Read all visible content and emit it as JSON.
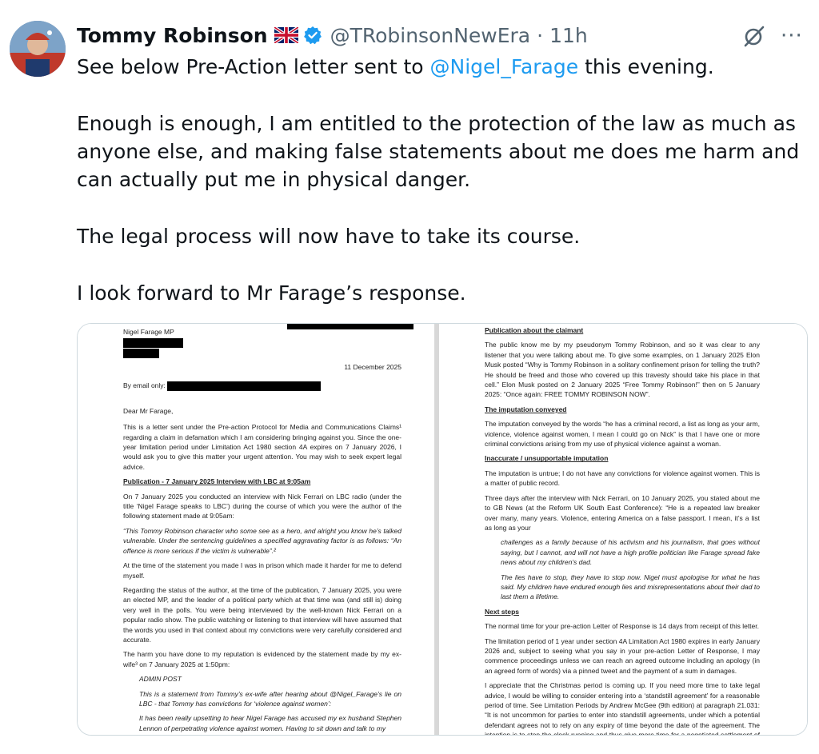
{
  "tweet": {
    "author_name": "Tommy Robinson",
    "flag_icon": "uk-flag-icon",
    "handle": "@TRobinsonNewEra",
    "separator": "·",
    "time": "11h",
    "more_label": "···",
    "text_1": "See below Pre-Action letter sent to",
    "mention": "@Nigel_Farage",
    "text_1_end": "this evening.",
    "paragraph_2": "Enough is enough, I am entitled to the protection of the law as much as anyone else, and making false statements about me does me harm and can actually put me in physical danger.",
    "paragraph_3": "The legal process will now have to take its course.",
    "paragraph_4": "I look forward to Mr Farage’s response.",
    "accent_color": "#1d9bf0",
    "verified_color": "#1d9bf0"
  },
  "letter_left": {
    "recipient": "Nigel Farage MP",
    "date": "11 December 2025",
    "by_email": "By email only:",
    "salutation": "Dear Mr Farage,",
    "p1": "This is a letter sent under the Pre-action Protocol for Media and Communications Claims¹ regarding a claim in defamation which I am considering bringing against you. Since the one-year limitation period under Limitation Act 1980 section 4A expires on 7 January 2026, I would ask you to give this matter your urgent attention. You may wish to seek expert legal advice.",
    "heading_publication": "Publication - 7 January 2025 Interview with LBC at 9:05am",
    "p2": "On 7 January 2025 you conducted an interview with Nick Ferrari on LBC radio (under the title ‘Nigel Farage speaks to LBC’) during the course of which you were the author of the following statement made at 9:05am:",
    "quote1": "“This Tommy Robinson character who some see as a hero, and alright you know he’s talked vulnerable. Under the sentencing guidelines a specified aggravating factor is as follows: “An offence is more serious if the victim is vulnerable”.²",
    "p3": "At the time of the statement you made I was in prison which made it harder for me to defend myself.",
    "p4": "Regarding the status of the author, at the time of the publication, 7 January 2025, you were an elected MP, and the leader of a political party which at that time was (and still is) doing very well in the polls. You were being interviewed by the well-known Nick Ferrari on a popular radio show. The public watching or listening to that interview will have assumed that the words you used in that context about my convictions were very carefully considered and accurate.",
    "p5": "The harm you have done to my reputation is evidenced by the statement made by my ex-wife³ on 7 January 2025 at 1:50pm:",
    "admin_post": "ADMIN POST",
    "quote2": "This is a statement from Tommy’s ex-wife after hearing about @Nigel_Farage’s lie on LBC - that Tommy has convictions for ‘violence against women’:",
    "quote3": "It has been really upsetting to hear Nigel Farage has accused my ex husband Stephen Lennon of perpetrating violence against women. Having to sit down and talk to my"
  },
  "letter_right": {
    "h_publication": "Publication about the claimant",
    "p1": "The public know me by my pseudonym Tommy Robinson, and so it was clear to any listener that you were talking about me. To give some examples, on 1 January 2025 Elon Musk posted “Why is Tommy Robinson in a solitary confinement prison for telling the truth? He should be freed and those who covered up this travesty should take his place in that cell.” Elon Musk posted on 2 January 2025 “Free Tommy Robinson!” then on 5 January 2025: “Once again: FREE TOMMY ROBINSON NOW”.",
    "h_imputation": "The imputation conveyed",
    "p2": "The imputation conveyed by the words “he has a criminal record, a list as long as your arm, violence, violence against women, I mean I could go on Nick” is that I have one or more criminal convictions arising from my use of physical violence against a woman.",
    "h_inaccurate": "Inaccurate / unsupportable imputation",
    "p3": "The imputation is untrue; I do not have any convictions for violence against women. This is a matter of public record.",
    "p4": "Three days after the interview with Nick Ferrari, on 10 January 2025, you stated about me to GB News (at the Reform UK South East Conference): “He is a repeated law breaker over many, many years. Violence, entering America on a false passport. I mean, it’s a list as long as your",
    "quote1": "challenges as a family because of his activism and his journalism, that goes without saying, but I cannot, and will not have a high profile politician like Farage spread fake news about my children’s dad.",
    "quote2": "The lies have to stop, they have to stop now. Nigel must apologise for what he has said. My children have endured enough lies and misrepresentations about their dad to last them a lifetime.",
    "h_next": "Next steps",
    "p5": "The normal time for your pre-action Letter of Response is 14 days from receipt of this letter.",
    "p6": "The limitation period of 1 year under section 4A Limitation Act 1980 expires in early January 2026 and, subject to seeing what you say in your pre-action Letter of Response, I may commence proceedings unless we can reach an agreed outcome including an apology (in an agreed form of words) via a pinned tweet and the payment of a sum in damages.",
    "p7": "I appreciate that the Christmas period is coming up. If you need more time to take legal advice, I would be willing to consider entering into a ‘standstill agreement’ for a reasonable period of time. See Limitation Periods by Andrew McGee (9th edition) at paragraph 21.031: “It is not uncommon for parties to enter into standstill agreements, under which a potential defendant agrees not to rely on any expiry of time beyond the date of the agreement. The intention is to stop the clock running and thus give more time for a negotiated settlement of the action"
  }
}
